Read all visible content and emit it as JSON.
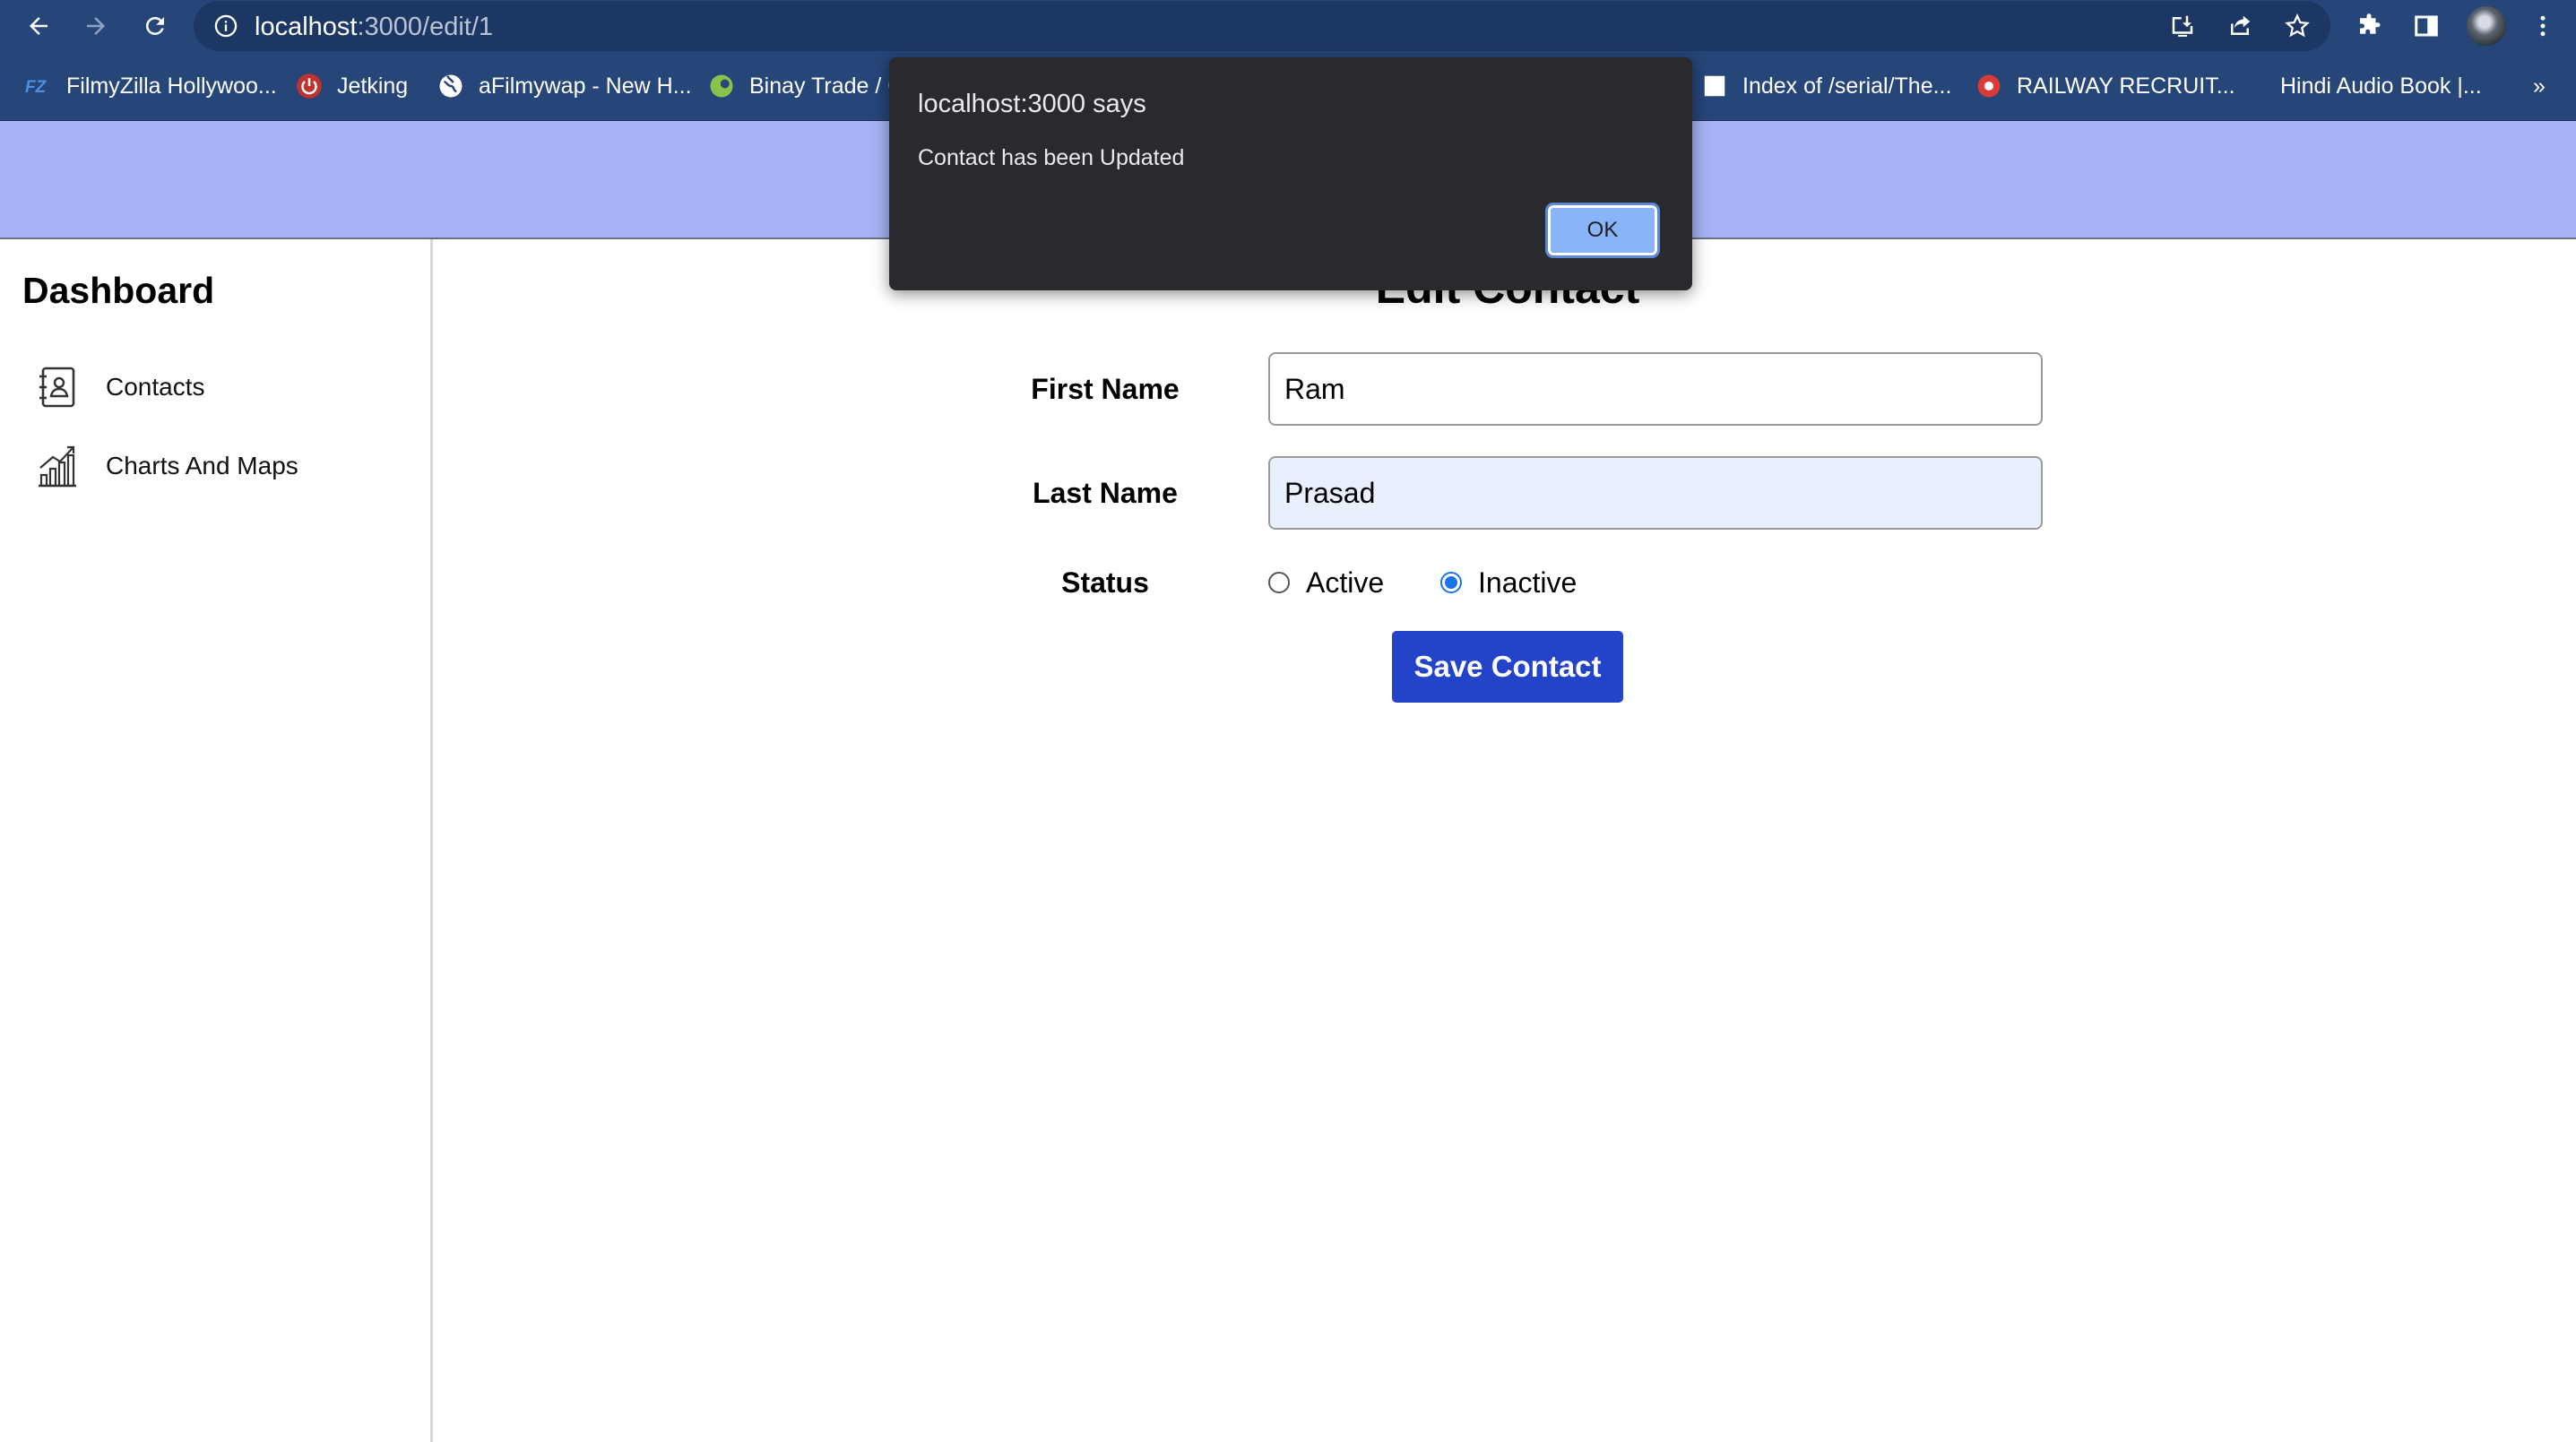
{
  "browser": {
    "url_host": "localhost",
    "url_path": ":3000/edit/1",
    "bookmarks": [
      {
        "label": "FilmyZilla Hollywoo..."
      },
      {
        "label": "Jetking"
      },
      {
        "label": "aFilmywap - New H..."
      },
      {
        "label": "Binay Trade / C"
      },
      {
        "label": "Index of /serial/The..."
      },
      {
        "label": "RAILWAY RECRUIT..."
      },
      {
        "label": "Hindi Audio Book |..."
      }
    ],
    "overflow_label": "»"
  },
  "sidebar": {
    "title": "Dashboard",
    "items": [
      {
        "label": "Contacts",
        "icon": "contacts-book-icon"
      },
      {
        "label": "Charts And Maps",
        "icon": "bar-chart-icon"
      }
    ]
  },
  "form": {
    "title": "Edit Contact",
    "first_name_label": "First Name",
    "first_name_value": "Ram",
    "last_name_label": "Last Name",
    "last_name_value": "Prasad",
    "status_label": "Status",
    "status_options": [
      "Active",
      "Inactive"
    ],
    "status_selected": "Inactive",
    "save_label": "Save Contact"
  },
  "dialog": {
    "title": "localhost:3000 says",
    "message": "Contact has been Updated",
    "ok_label": "OK"
  },
  "colors": {
    "chrome": "#264579",
    "header_band": "#a7b3f5",
    "save_button": "#2344c8",
    "dialog_bg": "#292a2d",
    "ok_button": "#8ab4f8"
  }
}
